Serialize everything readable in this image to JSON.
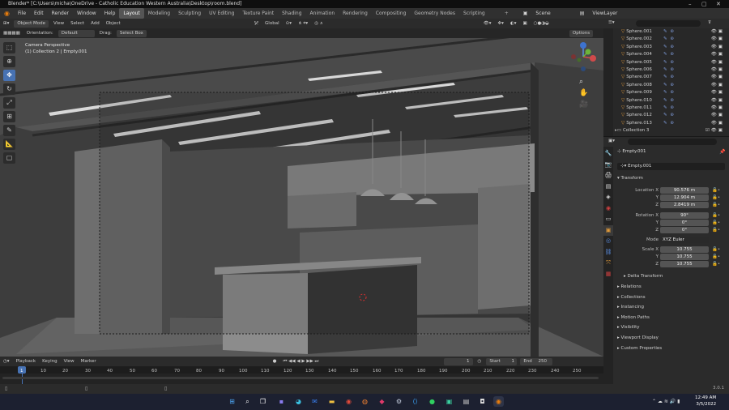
{
  "window": {
    "title": "Blender* [C:\\Users\\micha\\OneDrive - Catholic Education Western Australia\\Desktop\\room.blend]"
  },
  "menu": {
    "items": [
      "File",
      "Edit",
      "Render",
      "Window",
      "Help"
    ]
  },
  "workspaces": [
    "Layout",
    "Modeling",
    "Sculpting",
    "UV Editing",
    "Texture Paint",
    "Shading",
    "Animation",
    "Rendering",
    "Compositing",
    "Geometry Nodes",
    "Scripting"
  ],
  "scene": {
    "label": "Scene",
    "view_layer": "ViewLayer"
  },
  "header3d": {
    "mode": "Object Mode",
    "view": "View",
    "select": "Select",
    "add": "Add",
    "object": "Object",
    "transform": "Global"
  },
  "toolsettings": {
    "orientation_label": "Orientation:",
    "orientation_value": "Default",
    "drag_label": "Drag:",
    "drag_value": "Select Box",
    "options": "Options"
  },
  "viewport": {
    "camera_title": "Camera Perspective",
    "collection_info": "(1) Collection 2 | Empty.001"
  },
  "outliner": {
    "items": [
      "Sphere.001",
      "Sphere.002",
      "Sphere.003",
      "Sphere.004",
      "Sphere.005",
      "Sphere.006",
      "Sphere.007",
      "Sphere.008",
      "Sphere.009",
      "Sphere.010",
      "Sphere.011",
      "Sphere.012",
      "Sphere.013"
    ],
    "collection": "Collection 3"
  },
  "properties": {
    "object_name": "Empty.001",
    "object_field": "Empty.001",
    "transform_title": "Transform",
    "location": {
      "label": "Location X",
      "x": "90.576 m",
      "y": "12.904 m",
      "z": "2.8419 m"
    },
    "rotation": {
      "label": "Rotation X",
      "x": "90°",
      "y": "0°",
      "z": "0°"
    },
    "mode": {
      "label": "Mode",
      "value": "XYZ Euler"
    },
    "scale": {
      "label": "Scale X",
      "x": "10.755",
      "y": "10.755",
      "z": "10.755"
    },
    "axis_y": "Y",
    "axis_z": "Z",
    "sections": [
      "Delta Transform",
      "Relations",
      "Collections",
      "Instancing",
      "Motion Paths",
      "Visibility",
      "Viewport Display",
      "Custom Properties"
    ]
  },
  "timeline": {
    "playback": "Playback",
    "keying": "Keying",
    "view": "View",
    "marker": "Marker",
    "current_frame": "1",
    "start_label": "Start",
    "start": "1",
    "end_label": "End",
    "end": "250",
    "ticks": [
      "1",
      "10",
      "20",
      "30",
      "40",
      "50",
      "60",
      "70",
      "80",
      "90",
      "100",
      "110",
      "120",
      "130",
      "140",
      "150",
      "160",
      "170",
      "180",
      "190",
      "200",
      "210",
      "220",
      "230",
      "240",
      "250"
    ]
  },
  "statusbar": {
    "version": "3.0.1"
  },
  "taskbar": {
    "time": "12:49 AM",
    "date": "3/5/2022"
  }
}
